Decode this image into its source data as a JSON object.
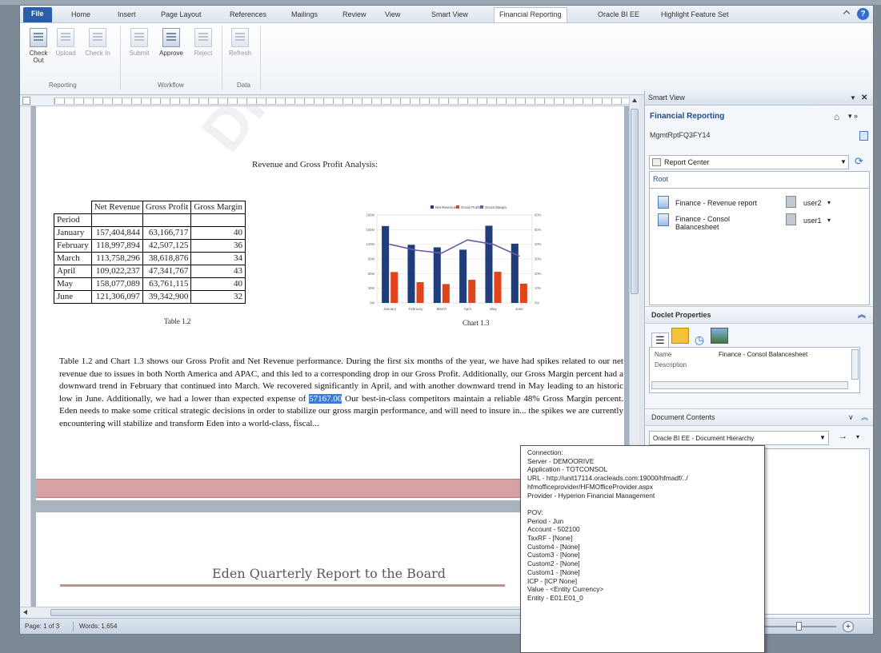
{
  "tabs": [
    "File",
    "Home",
    "Insert",
    "Page Layout",
    "References",
    "Mailings",
    "Review",
    "View",
    "Smart View",
    "Financial Reporting",
    "Oracle BI EE",
    "Highlight Feature Set"
  ],
  "ribbon": {
    "buttons": [
      "Check Out",
      "Upload",
      "Check In",
      "Submit",
      "Approve",
      "Reject",
      "Refresh"
    ],
    "groups": [
      "Reporting",
      "Workflow",
      "Data"
    ]
  },
  "document": {
    "title": "Revenue and Gross Profit Analysis:",
    "table": {
      "headers": [
        "",
        "Net Revenue",
        "Gross Profit",
        "Gross Margin"
      ],
      "period_label": "Period",
      "rows": [
        [
          "January",
          "157,404,844",
          "63,166,717",
          "40"
        ],
        [
          "February",
          "118,997,894",
          "42,507,125",
          "36"
        ],
        [
          "March",
          "113,758,296",
          "38,618,876",
          "34"
        ],
        [
          "April",
          "109,022,237",
          "47,341,767",
          "43"
        ],
        [
          "May",
          "158,077,089",
          "63,761,115",
          "40"
        ],
        [
          "June",
          "121,306,097",
          "39,342,900",
          "32"
        ]
      ],
      "caption": "Table 1.2"
    },
    "chart_caption": "Chart 1.3",
    "paragraph_before": "Table 1.2 and Chart 1.3 shows our Gross Profit and Net Revenue performance.   During the first six months of the year, we have had spikes related to our net revenue due to issues in both North America and APAC, and this led to a corresponding drop in our Gross Profit.   Additionally, our Gross Margin percent had a downward trend in February that continued into March.   We recovered significantly in April, and with another downward trend in May leading to an historic low in June. Additionally, we had a lower than expected expense of ",
    "highlight": "57167.00",
    "paragraph_after": " Our best-in-class competitors maintain a reliable 48% Gross Margin percent.   Eden needs to make some critical strategic decisions in order to stabilize our gross margin performance, and will need to insure in... the spikes we are currently encountering will stabilize and transform Eden into a world-class, fiscal...",
    "page2_heading": "Eden Quarterly Report to the Board"
  },
  "chart_data": {
    "type": "bar",
    "categories": [
      "January",
      "February",
      "March",
      "April",
      "May",
      "June"
    ],
    "series": [
      {
        "name": "Net Revenue",
        "values": [
          157404844,
          118997894,
          113758296,
          109022237,
          158077089,
          121306097
        ]
      },
      {
        "name": "Gross Profit",
        "values": [
          63166717,
          42507125,
          38618876,
          47341767,
          63761115,
          39342900
        ]
      },
      {
        "name": "Gross Margin",
        "values": [
          40,
          36,
          34,
          43,
          40,
          32
        ]
      }
    ],
    "colors": {
      "Net Revenue": "#1f3d7a",
      "Gross Profit": "#e0441b",
      "Gross Margin": "#6a5aa8"
    },
    "ylim": [
      0,
      180000000
    ],
    "y2lim": [
      0,
      60
    ],
    "legend": "top"
  },
  "status": {
    "page": "Page: 1 of 3",
    "words": "Words: 1,654"
  },
  "smartview": {
    "header": "Smart View",
    "title": "Financial Reporting",
    "server": "MgmtRptFQ3FY14",
    "dropdown": "Report Center",
    "root": "Root",
    "items": [
      {
        "name": "Finance - Revenue report",
        "user": "user2"
      },
      {
        "name": "Finance - Consol Balancesheet",
        "user": "user1"
      }
    ],
    "doclet_header": "Doclet Properties",
    "properties": [
      {
        "key": "Name",
        "value": "Finance - Consol Balancesheet"
      },
      {
        "key": "Description",
        "value": ""
      }
    ],
    "doc_contents_header": "Document Contents",
    "hierarchy_dropdown": "Oracle BI EE - Document Hierarchy"
  },
  "tooltip": {
    "lines": [
      "Connection:",
      "   Server - DEMOORIVE",
      "   Application - TOTCONSOL",
      "   URL - http://unit17114.oracleads.com:19000/hfmadf/../",
      "hfmofficeprovider/HFMOfficeProvider.aspx",
      "   Provider - Hyperion Financial Management",
      "",
      "POV:",
      "   Period - Jun",
      "   Account - 502100",
      "   TaxRF - [None]",
      "   Custom4 - [None]",
      "   Custom3 - [None]",
      "   Custom2 - [None]",
      "   Custom1 - [None]",
      "   ICP - [ICP None]",
      "   Value - <Entity Currency>",
      "   Entity - E01.E01_0"
    ]
  }
}
